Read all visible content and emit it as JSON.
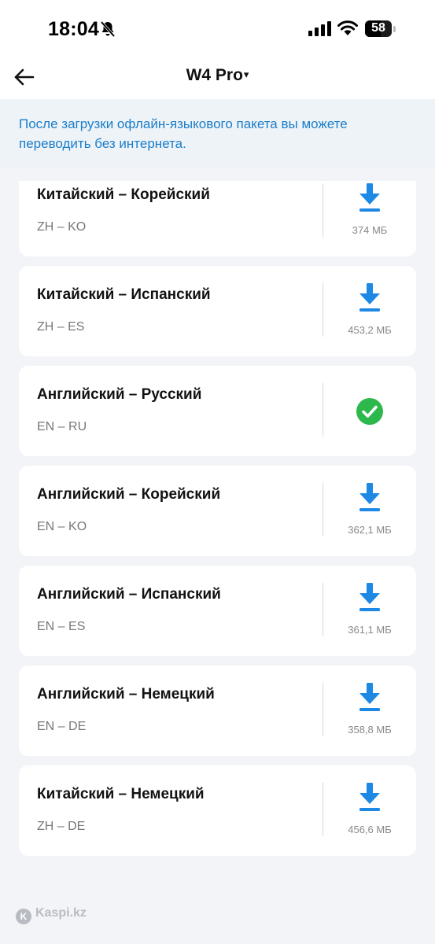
{
  "status_bar": {
    "time": "18:04",
    "battery_percent": "58",
    "battery_level": 0.58,
    "icons": [
      "bell-muted-icon",
      "cellular-signal-icon",
      "wifi-icon",
      "battery-icon"
    ]
  },
  "header": {
    "title": "W4 Pro",
    "caret": "▾",
    "back_icon": "arrow-left-icon"
  },
  "info": {
    "text": "После загрузки офлайн-языкового пакета вы можете переводить без интернета."
  },
  "packs": [
    {
      "name": "Китайский – Корейский",
      "code": "ZH – KO",
      "size": "374 МБ",
      "status": "download"
    },
    {
      "name": "Китайский – Испанский",
      "code": "ZH – ES",
      "size": "453,2 МБ",
      "status": "download"
    },
    {
      "name": "Английский – Русский",
      "code": "EN – RU",
      "size": "",
      "status": "downloaded"
    },
    {
      "name": "Английский – Корейский",
      "code": "EN – KO",
      "size": "362,1 МБ",
      "status": "download"
    },
    {
      "name": "Английский – Испанский",
      "code": "EN – ES",
      "size": "361,1 МБ",
      "status": "download"
    },
    {
      "name": "Английский – Немецкий",
      "code": "EN – DE",
      "size": "358,8 МБ",
      "status": "download"
    },
    {
      "name": "Китайский – Немецкий",
      "code": "ZH – DE",
      "size": "456,6 МБ",
      "status": "download"
    }
  ],
  "colors": {
    "accent": "#1e88e5",
    "success": "#2db84c",
    "info_text": "#1a7dc9",
    "background": "#f3f4f7"
  },
  "watermark": {
    "text": "Kaspi.kz"
  }
}
